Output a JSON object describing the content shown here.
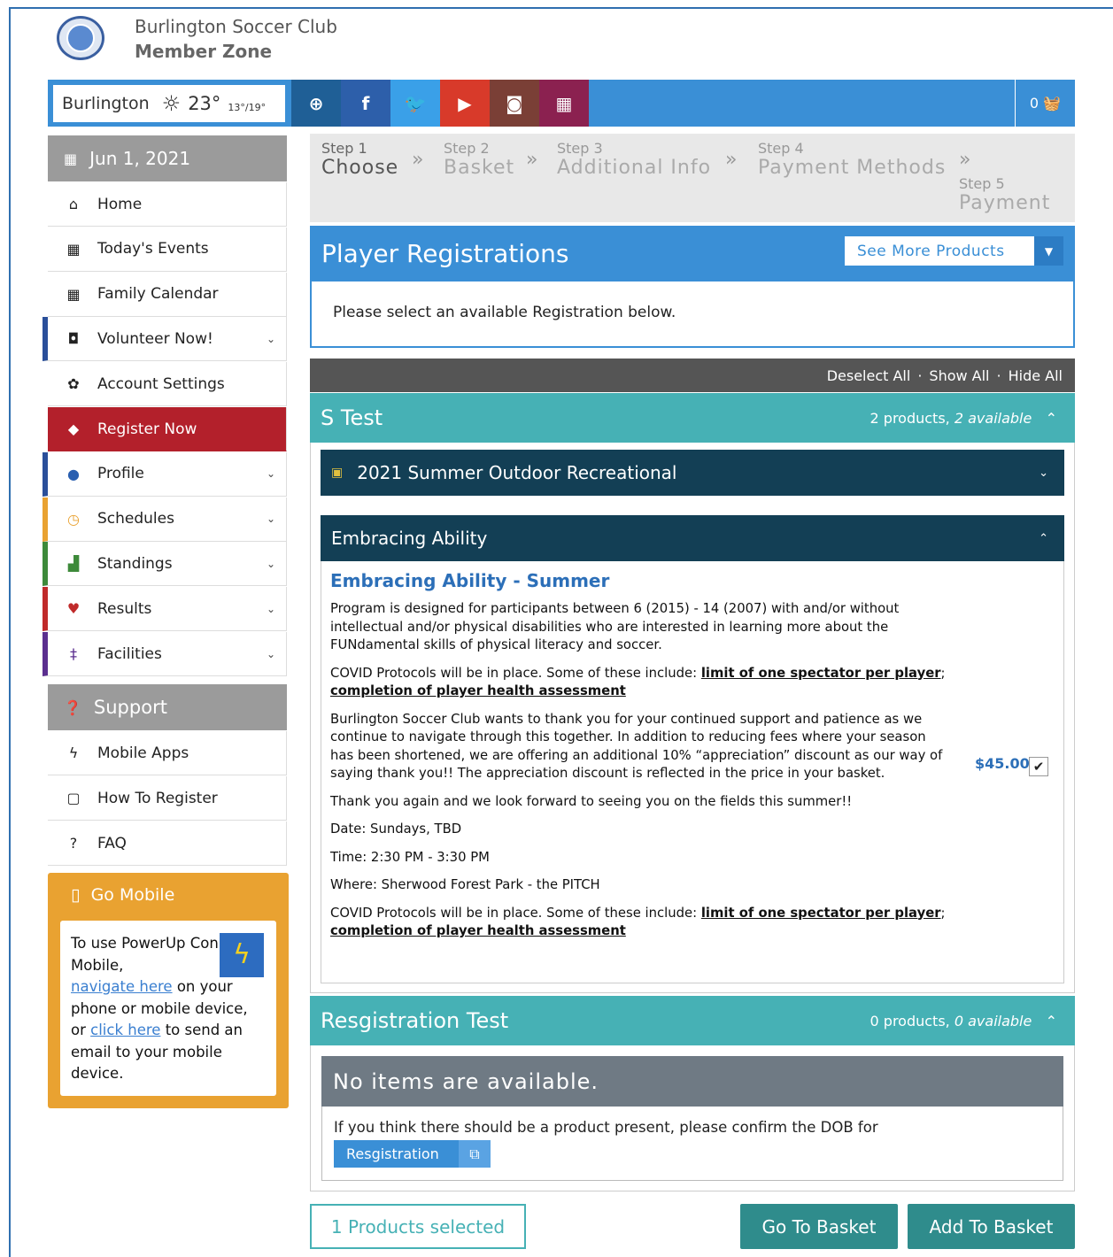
{
  "header": {
    "club_name": "Burlington Soccer Club",
    "club_sub": "Member Zone"
  },
  "topbar": {
    "city": "Burlington",
    "temperature": "23°",
    "temp_range": "13°/19°",
    "social": [
      {
        "icon": "globe-icon",
        "glyph": "⊕",
        "color": "#1f5f96"
      },
      {
        "icon": "facebook-icon",
        "glyph": "f",
        "color": "#2d5faa"
      },
      {
        "icon": "twitter-icon",
        "glyph": "🐦",
        "color": "#3aa0e8"
      },
      {
        "icon": "youtube-icon",
        "glyph": "▶",
        "color": "#d83a2a"
      },
      {
        "icon": "instagram-icon",
        "glyph": "◙",
        "color": "#7a3f36"
      },
      {
        "icon": "calendar-icon",
        "glyph": "▦",
        "color": "#8b2150"
      }
    ],
    "cart_count": "0"
  },
  "sidebar": {
    "date": "Jun 1, 2021",
    "items": [
      {
        "label": "Home",
        "icon": "home-icon",
        "glyph": "⌂"
      },
      {
        "label": "Today's Events",
        "icon": "calendar-icon",
        "glyph": "▦"
      },
      {
        "label": "Family Calendar",
        "icon": "calendar-icon",
        "glyph": "▦"
      },
      {
        "label": "Volunteer Now!",
        "icon": "volunteer-icon",
        "glyph": "◘"
      },
      {
        "label": "Account Settings",
        "icon": "gear-icon",
        "glyph": "✿"
      },
      {
        "label": "Register Now",
        "icon": "tag-icon",
        "glyph": "◆"
      },
      {
        "label": "Profile",
        "icon": "user-icon",
        "glyph": "●"
      },
      {
        "label": "Schedules",
        "icon": "clock-icon",
        "glyph": "◷"
      },
      {
        "label": "Standings",
        "icon": "bar-chart-icon",
        "glyph": "▟"
      },
      {
        "label": "Results",
        "icon": "trophy-icon",
        "glyph": "♥"
      },
      {
        "label": "Facilities",
        "icon": "map-pin-icon",
        "glyph": "‡"
      }
    ],
    "support_title": "Support",
    "support_items": [
      {
        "label": "Mobile Apps",
        "icon": "bolt-icon",
        "glyph": "ϟ"
      },
      {
        "label": "How To Register",
        "icon": "pdf-icon",
        "glyph": "▢"
      },
      {
        "label": "FAQ",
        "icon": "question-icon",
        "glyph": "?"
      }
    ],
    "gomobile": {
      "title": "Go Mobile",
      "text1": "To use PowerUp Connect Mobile,",
      "link1": "navigate here",
      "text2": "on your phone or mobile device, or",
      "link2": "click here",
      "text3": "to send an email to your mobile device."
    }
  },
  "steps": [
    {
      "num": "Step 1",
      "label": "Choose"
    },
    {
      "num": "Step 2",
      "label": "Basket"
    },
    {
      "num": "Step 3",
      "label": "Additional Info"
    },
    {
      "num": "Step 4",
      "label": "Payment Methods"
    },
    {
      "num": "Step 5",
      "label": "Payment"
    }
  ],
  "registrations": {
    "title": "Player Registrations",
    "see_more": "See More Products",
    "instruction": "Please select an available Registration below.",
    "deselect_all": "Deselect All",
    "show_all": "Show All",
    "hide_all": "Hide All"
  },
  "group1": {
    "title": "S Test",
    "meta_count": "2 products,",
    "meta_avail": "2 available",
    "category1": "2021 Summer Outdoor Recreational",
    "category2": "Embracing Ability",
    "product": {
      "title": "Embracing Ability - Summer",
      "p1": "Program is designed for participants between 6 (2015) - 14 (2007) with and/or without intellectual and/or physical disabilities who are interested in learning more about the FUNdamental skills of physical literacy and soccer.",
      "covid_prefix": "COVID Protocols will be in place. Some of these include:",
      "covid_link1": "limit of one spectator per player",
      "covid_sep": ";",
      "covid_link2": "completion of player health assessment",
      "p3": "Burlington Soccer Club wants to thank you for your continued support and patience as we continue to navigate through this together. In addition to reducing fees where your season has been shortened, we are offering an additional 10% “appreciation” discount as our way of saying thank you!! The appreciation discount is reflected in the price in your basket.",
      "p4": "Thank you again and we look forward to seeing you on the fields this summer!!",
      "date": "Date: Sundays, TBD",
      "time": "Time: 2:30 PM - 3:30 PM",
      "where": "Where: Sherwood Forest Park - the PITCH",
      "price": "$45.00",
      "checked": "✔"
    }
  },
  "group2": {
    "title": "Resgistration Test",
    "meta_count": "0 products,",
    "meta_avail": "0 available",
    "no_items": "No items are available.",
    "confirm_text": "If you think there should be a product present, please confirm the DOB for",
    "reg_button": "Resgistration"
  },
  "footer": {
    "selected": "1 Products selected",
    "go_basket": "Go To Basket",
    "add_basket": "Add To Basket"
  }
}
